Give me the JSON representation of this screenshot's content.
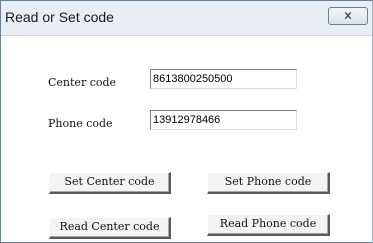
{
  "window": {
    "title": "Read or Set code",
    "close_icon": "close-icon"
  },
  "form": {
    "center_code_label": "Center code",
    "center_code_value": "8613800250500",
    "phone_code_label": "Phone code",
    "phone_code_value": "13912978466"
  },
  "buttons": {
    "set_center": "Set Center code",
    "set_phone": "Set Phone code",
    "read_center": "Read Center code",
    "read_phone": "Read Phone code"
  }
}
